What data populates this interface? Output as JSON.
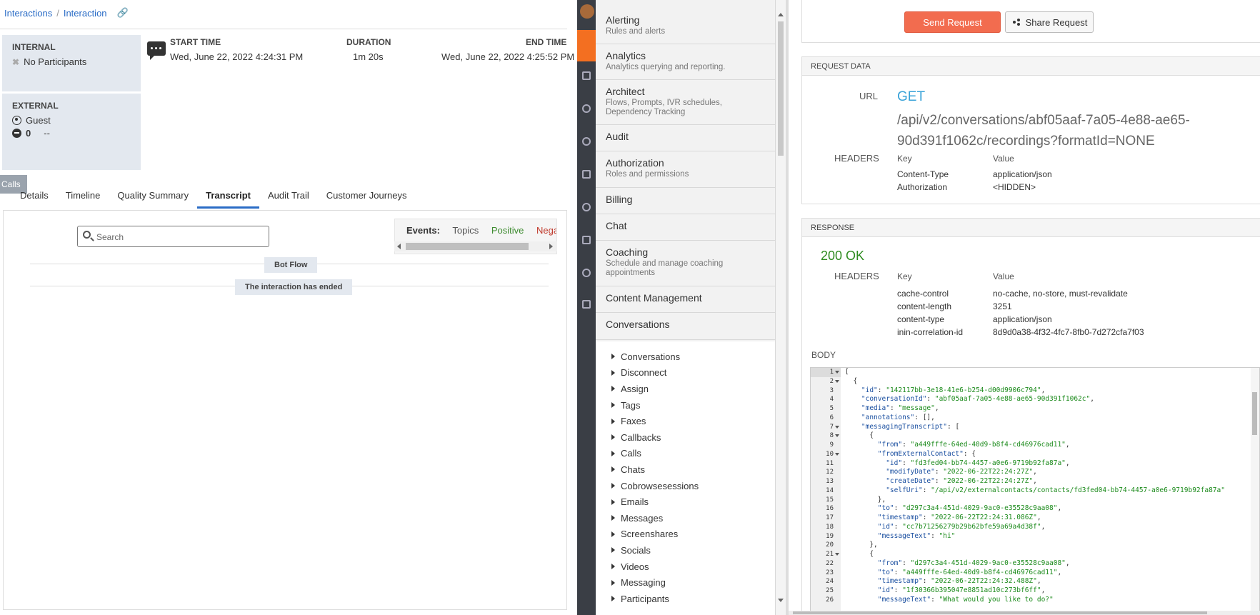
{
  "breadcrumb": {
    "interactions": "Interactions",
    "sep": "/",
    "interaction": "Interaction"
  },
  "participants": {
    "internal_title": "INTERNAL",
    "internal_value": "No Participants",
    "external_title": "EXTERNAL",
    "external_guest": "Guest",
    "external_count": "0",
    "external_dash": "--"
  },
  "meta": {
    "start_label": "START TIME",
    "start_value": "Wed, June 22, 2022 4:24:31 PM",
    "duration_label": "DURATION",
    "duration_value": "1m 20s",
    "end_label": "END TIME",
    "end_value": "Wed, June 22, 2022 4:25:52 PM"
  },
  "calls_tag": "Calls",
  "tabs": [
    "Details",
    "Timeline",
    "Quality Summary",
    "Transcript",
    "Audit Trail",
    "Customer Journeys"
  ],
  "active_tab": "Transcript",
  "transcript": {
    "search_placeholder": "Search",
    "events_label": "Events:",
    "events_topics": "Topics",
    "events_positive": "Positive",
    "events_negative": "Negat",
    "pill_bot": "Bot Flow",
    "pill_end": "The interaction has ended"
  },
  "categories": [
    {
      "name": "Alerting",
      "desc": "Rules and alerts"
    },
    {
      "name": "Analytics",
      "desc": "Analytics querying and reporting."
    },
    {
      "name": "Architect",
      "desc": "Flows, Prompts, IVR schedules, Dependency Tracking"
    },
    {
      "name": "Audit",
      "desc": ""
    },
    {
      "name": "Authorization",
      "desc": "Roles and permissions"
    },
    {
      "name": "Billing",
      "desc": ""
    },
    {
      "name": "Chat",
      "desc": ""
    },
    {
      "name": "Coaching",
      "desc": "Schedule and manage coaching appointments"
    },
    {
      "name": "Content Management",
      "desc": ""
    },
    {
      "name": "Conversations",
      "desc": ""
    }
  ],
  "sub_items": [
    "Conversations",
    "Disconnect",
    "Assign",
    "Tags",
    "Faxes",
    "Callbacks",
    "Calls",
    "Chats",
    "Cobrowsesessions",
    "Emails",
    "Messages",
    "Screenshares",
    "Socials",
    "Videos",
    "Messaging",
    "Participants"
  ],
  "request": {
    "send_label": "Send Request",
    "share_label": "Share Request",
    "section_title": "REQUEST DATA",
    "url_label": "URL",
    "method": "GET",
    "path_line1": "/api/v2/conversations/abf05aaf-7a05-4e88-ae65-",
    "path_line2": "90d391f1062c/recordings?formatId=NONE",
    "headers_label": "HEADERS",
    "key_col": "Key",
    "value_col": "Value",
    "headers": [
      {
        "k": "Content-Type",
        "v": "application/json"
      },
      {
        "k": "Authorization",
        "v": "<HIDDEN>"
      }
    ]
  },
  "response": {
    "section_title": "RESPONSE",
    "status": "200 OK",
    "headers_label": "HEADERS",
    "key_col": "Key",
    "value_col": "Value",
    "headers": [
      {
        "k": "cache-control",
        "v": "no-cache, no-store, must-revalidate"
      },
      {
        "k": "content-length",
        "v": "3251"
      },
      {
        "k": "content-type",
        "v": "application/json"
      },
      {
        "k": "inin-correlation-id",
        "v": "8d9d0a38-4f32-4fc7-8fb0-7d272cfa7f03"
      }
    ],
    "body_label": "BODY"
  },
  "code_lines": [
    "[",
    "  {",
    "    \"id\": \"142117bb-3e18-41e6-b254-d00d9906c794\",",
    "    \"conversationId\": \"abf05aaf-7a05-4e88-ae65-90d391f1062c\",",
    "    \"media\": \"message\",",
    "    \"annotations\": [],",
    "    \"messagingTranscript\": [",
    "      {",
    "        \"from\": \"a449fffe-64ed-40d9-b8f4-cd46976cad11\",",
    "        \"fromExternalContact\": {",
    "          \"id\": \"fd3fed04-bb74-4457-a0e6-9719b92fa87a\",",
    "          \"modifyDate\": \"2022-06-22T22:24:27Z\",",
    "          \"createDate\": \"2022-06-22T22:24:27Z\",",
    "          \"selfUri\": \"/api/v2/externalcontacts/contacts/fd3fed04-bb74-4457-a0e6-9719b92fa87a\"",
    "        },",
    "        \"to\": \"d297c3a4-451d-4029-9ac0-e35528c9aa08\",",
    "        \"timestamp\": \"2022-06-22T22:24:31.086Z\",",
    "        \"id\": \"cc7b71256279b29b62bfe59a69a4d38f\",",
    "        \"messageText\": \"hi\"",
    "      },",
    "      {",
    "        \"from\": \"d297c3a4-451d-4029-9ac0-e35528c9aa08\",",
    "        \"to\": \"a449fffe-64ed-40d9-b8f4-cd46976cad11\",",
    "        \"timestamp\": \"2022-06-22T22:24:32.488Z\",",
    "        \"id\": \"1f30366b395047e8851ad10c273bf6ff\",",
    "        \"messageText\": \"What would you like to do?\""
  ]
}
